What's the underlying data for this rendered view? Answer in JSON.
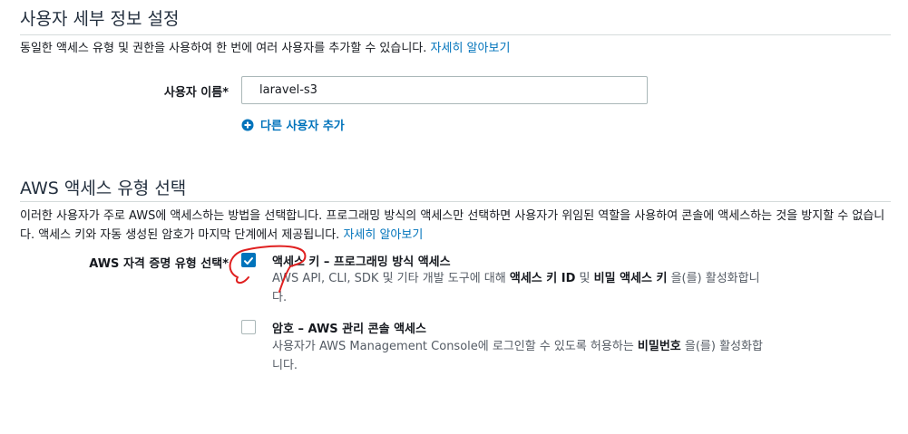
{
  "user_details": {
    "heading": "사용자 세부 정보 설정",
    "description": "동일한 액세스 유형 및 권한을 사용하여 한 번에 여러 사용자를 추가할 수 있습니다.",
    "learn_more": "자세히 알아보기",
    "username_label": "사용자 이름*",
    "username_value": "laravel-s3",
    "add_user_label": "다른 사용자 추가"
  },
  "access_type": {
    "heading": "AWS 액세스 유형 선택",
    "description": "이러한 사용자가 주로 AWS에 액세스하는 방법을 선택합니다. 프로그래밍 방식의 액세스만 선택하면 사용자가 위임된 역할을 사용하여 콘솔에 액세스하는 것을 방지할 수 없습니다. 액세스 키와 자동 생성된 암호가 마지막 단계에서 제공됩니다.",
    "learn_more": "자세히 알아보기",
    "credential_label": "AWS 자격 증명 유형 선택*",
    "options": [
      {
        "title": "액세스 키 – 프로그래밍 방식 액세스",
        "checked": true,
        "desc_prefix": "AWS API, CLI, SDK 및 기타 개발 도구에 대해 ",
        "desc_bold1": "액세스 키 ID",
        "desc_mid": " 및 ",
        "desc_bold2": "비밀 액세스 키",
        "desc_suffix": " 을(를) 활성화합니다."
      },
      {
        "title": "암호 – AWS 관리 콘솔 액세스",
        "checked": false,
        "desc_prefix": "사용자가 AWS Management Console에 로그인할 수 있도록 허용하는 ",
        "desc_bold1": "비밀번호",
        "desc_suffix": " 을(를) 활성화합니다."
      }
    ]
  },
  "colors": {
    "link": "#0073bb",
    "checkbox_checked": "#0073bb",
    "annotation": "#e02020"
  },
  "icons": [
    "plus-circle-icon",
    "checkmark-icon"
  ]
}
